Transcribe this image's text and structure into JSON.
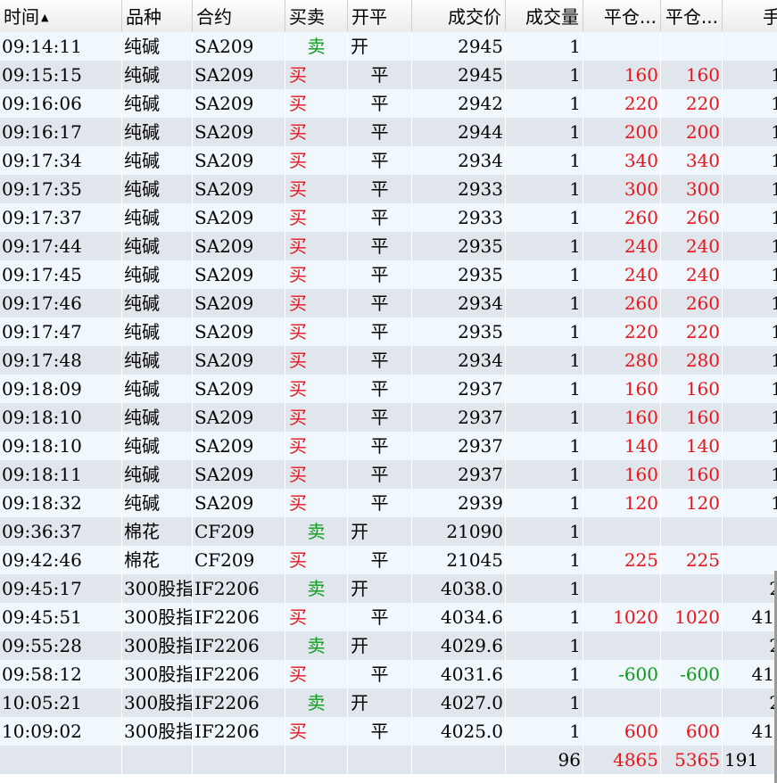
{
  "colors": {
    "buy": "#e8141b",
    "sell": "#0b9b18",
    "positive": "#e8141b",
    "negative": "#0b9b18"
  },
  "header": {
    "columns": [
      "时间",
      "品种",
      "合约",
      "买卖",
      "开平",
      "成交价",
      "成交量",
      "平仓...",
      "平仓...",
      "手"
    ],
    "sort_icon": "sort-asc-icon",
    "sort_glyph": "▲"
  },
  "rows": [
    {
      "time": "09:14:11",
      "product": "纯碱",
      "contract": "SA209",
      "side": "卖",
      "oc": "开",
      "price": "2945",
      "qty": "1",
      "pnl1": "",
      "pnl2": "",
      "fee": ""
    },
    {
      "time": "09:15:15",
      "product": "纯碱",
      "contract": "SA209",
      "side": "买",
      "oc": "平",
      "price": "2945",
      "qty": "1",
      "pnl1": "160",
      "pnl2": "160",
      "fee": "1"
    },
    {
      "time": "09:16:06",
      "product": "纯碱",
      "contract": "SA209",
      "side": "买",
      "oc": "平",
      "price": "2942",
      "qty": "1",
      "pnl1": "220",
      "pnl2": "220",
      "fee": "1"
    },
    {
      "time": "09:16:17",
      "product": "纯碱",
      "contract": "SA209",
      "side": "买",
      "oc": "平",
      "price": "2944",
      "qty": "1",
      "pnl1": "200",
      "pnl2": "200",
      "fee": "1"
    },
    {
      "time": "09:17:34",
      "product": "纯碱",
      "contract": "SA209",
      "side": "买",
      "oc": "平",
      "price": "2934",
      "qty": "1",
      "pnl1": "340",
      "pnl2": "340",
      "fee": "1"
    },
    {
      "time": "09:17:35",
      "product": "纯碱",
      "contract": "SA209",
      "side": "买",
      "oc": "平",
      "price": "2933",
      "qty": "1",
      "pnl1": "300",
      "pnl2": "300",
      "fee": "1"
    },
    {
      "time": "09:17:37",
      "product": "纯碱",
      "contract": "SA209",
      "side": "买",
      "oc": "平",
      "price": "2933",
      "qty": "1",
      "pnl1": "260",
      "pnl2": "260",
      "fee": "1"
    },
    {
      "time": "09:17:44",
      "product": "纯碱",
      "contract": "SA209",
      "side": "买",
      "oc": "平",
      "price": "2935",
      "qty": "1",
      "pnl1": "240",
      "pnl2": "240",
      "fee": "1"
    },
    {
      "time": "09:17:45",
      "product": "纯碱",
      "contract": "SA209",
      "side": "买",
      "oc": "平",
      "price": "2935",
      "qty": "1",
      "pnl1": "240",
      "pnl2": "240",
      "fee": "1"
    },
    {
      "time": "09:17:46",
      "product": "纯碱",
      "contract": "SA209",
      "side": "买",
      "oc": "平",
      "price": "2934",
      "qty": "1",
      "pnl1": "260",
      "pnl2": "260",
      "fee": "1"
    },
    {
      "time": "09:17:47",
      "product": "纯碱",
      "contract": "SA209",
      "side": "买",
      "oc": "平",
      "price": "2935",
      "qty": "1",
      "pnl1": "220",
      "pnl2": "220",
      "fee": "1"
    },
    {
      "time": "09:17:48",
      "product": "纯碱",
      "contract": "SA209",
      "side": "买",
      "oc": "平",
      "price": "2934",
      "qty": "1",
      "pnl1": "280",
      "pnl2": "280",
      "fee": "1"
    },
    {
      "time": "09:18:09",
      "product": "纯碱",
      "contract": "SA209",
      "side": "买",
      "oc": "平",
      "price": "2937",
      "qty": "1",
      "pnl1": "160",
      "pnl2": "160",
      "fee": "1"
    },
    {
      "time": "09:18:10",
      "product": "纯碱",
      "contract": "SA209",
      "side": "买",
      "oc": "平",
      "price": "2937",
      "qty": "1",
      "pnl1": "160",
      "pnl2": "160",
      "fee": "1"
    },
    {
      "time": "09:18:10",
      "product": "纯碱",
      "contract": "SA209",
      "side": "买",
      "oc": "平",
      "price": "2937",
      "qty": "1",
      "pnl1": "140",
      "pnl2": "140",
      "fee": "1"
    },
    {
      "time": "09:18:11",
      "product": "纯碱",
      "contract": "SA209",
      "side": "买",
      "oc": "平",
      "price": "2937",
      "qty": "1",
      "pnl1": "160",
      "pnl2": "160",
      "fee": "1"
    },
    {
      "time": "09:18:32",
      "product": "纯碱",
      "contract": "SA209",
      "side": "买",
      "oc": "平",
      "price": "2939",
      "qty": "1",
      "pnl1": "120",
      "pnl2": "120",
      "fee": "1"
    },
    {
      "time": "09:36:37",
      "product": "棉花",
      "contract": "CF209",
      "side": "卖",
      "oc": "开",
      "price": "21090",
      "qty": "1",
      "pnl1": "",
      "pnl2": "",
      "fee": ""
    },
    {
      "time": "09:42:46",
      "product": "棉花",
      "contract": "CF209",
      "side": "买",
      "oc": "平",
      "price": "21045",
      "qty": "1",
      "pnl1": "225",
      "pnl2": "225",
      "fee": ""
    },
    {
      "time": "09:45:17",
      "product": "300股指",
      "contract": "IF2206",
      "side": "卖",
      "oc": "开",
      "price": "4038.0",
      "qty": "1",
      "pnl1": "",
      "pnl2": "",
      "fee": "2"
    },
    {
      "time": "09:45:51",
      "product": "300股指",
      "contract": "IF2206",
      "side": "买",
      "oc": "平",
      "price": "4034.6",
      "qty": "1",
      "pnl1": "1020",
      "pnl2": "1020",
      "fee": "41"
    },
    {
      "time": "09:55:28",
      "product": "300股指",
      "contract": "IF2206",
      "side": "卖",
      "oc": "开",
      "price": "4029.6",
      "qty": "1",
      "pnl1": "",
      "pnl2": "",
      "fee": "2"
    },
    {
      "time": "09:58:12",
      "product": "300股指",
      "contract": "IF2206",
      "side": "买",
      "oc": "平",
      "price": "4031.6",
      "qty": "1",
      "pnl1": "-600",
      "pnl2": "-600",
      "fee": "41"
    },
    {
      "time": "10:05:21",
      "product": "300股指",
      "contract": "IF2206",
      "side": "卖",
      "oc": "开",
      "price": "4027.0",
      "qty": "1",
      "pnl1": "",
      "pnl2": "",
      "fee": "2"
    },
    {
      "time": "10:09:02",
      "product": "300股指",
      "contract": "IF2206",
      "side": "买",
      "oc": "平",
      "price": "4025.0",
      "qty": "1",
      "pnl1": "600",
      "pnl2": "600",
      "fee": "41"
    }
  ],
  "totals": {
    "qty": "96",
    "pnl1": "4865",
    "pnl2": "5365",
    "fee": "191"
  }
}
